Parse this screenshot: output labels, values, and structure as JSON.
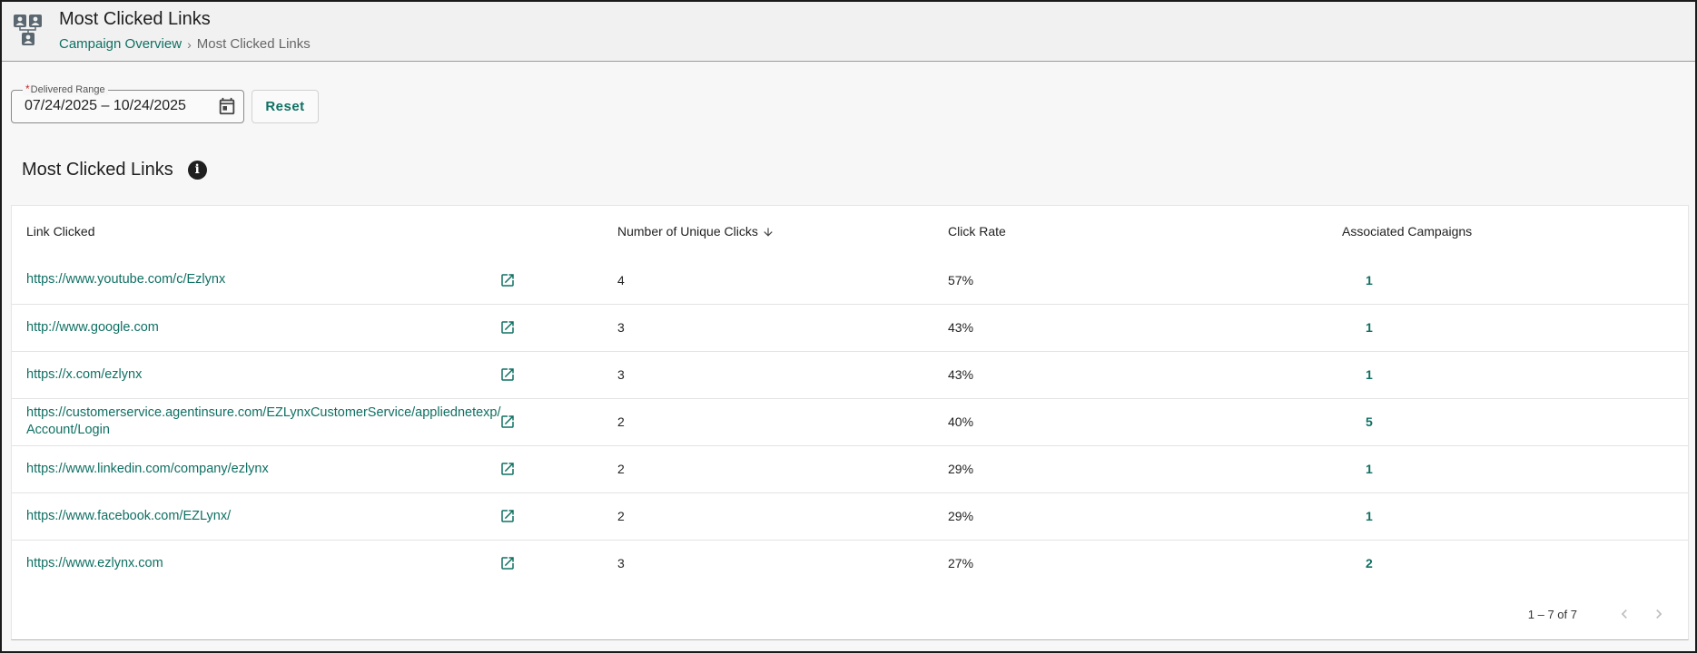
{
  "header": {
    "title": "Most Clicked Links",
    "breadcrumb": {
      "parent": "Campaign Overview",
      "separator": "›",
      "current": "Most Clicked Links"
    }
  },
  "filters": {
    "date_label": "Delivered Range",
    "required_marker": "*",
    "date_value": "07/24/2025 – 10/24/2025",
    "reset_label": "Reset"
  },
  "section": {
    "title": "Most Clicked Links",
    "info_glyph": "i"
  },
  "table": {
    "columns": {
      "link": "Link Clicked",
      "clicks": "Number of Unique Clicks",
      "rate": "Click Rate",
      "campaigns": "Associated Campaigns"
    },
    "sort_icon": "arrow-down-icon",
    "rows": [
      {
        "link_line1": "https://www.youtube.com/c/Ezlynx",
        "link_line2": "",
        "clicks": "4",
        "rate": "57%",
        "campaigns": "1"
      },
      {
        "link_line1": "http://www.google.com",
        "link_line2": "",
        "clicks": "3",
        "rate": "43%",
        "campaigns": "1"
      },
      {
        "link_line1": "https://x.com/ezlynx",
        "link_line2": "",
        "clicks": "3",
        "rate": "43%",
        "campaigns": "1"
      },
      {
        "link_line1": "https://customerservice.agentinsure.com/EZLynxCustomerService/appliednetexp/",
        "link_line2": "Account/Login",
        "clicks": "2",
        "rate": "40%",
        "campaigns": "5"
      },
      {
        "link_line1": "https://www.linkedin.com/company/ezlynx",
        "link_line2": "",
        "clicks": "2",
        "rate": "29%",
        "campaigns": "1"
      },
      {
        "link_line1": "https://www.facebook.com/EZLynx/",
        "link_line2": "",
        "clicks": "2",
        "rate": "29%",
        "campaigns": "1"
      },
      {
        "link_line1": "https://www.ezlynx.com",
        "link_line2": "",
        "clicks": "3",
        "rate": "27%",
        "campaigns": "2"
      }
    ]
  },
  "pager": {
    "range": "1 – 7 of 7"
  },
  "colors": {
    "accent": "#0f7063",
    "text": "#222222",
    "border": "#e3e3e3"
  }
}
